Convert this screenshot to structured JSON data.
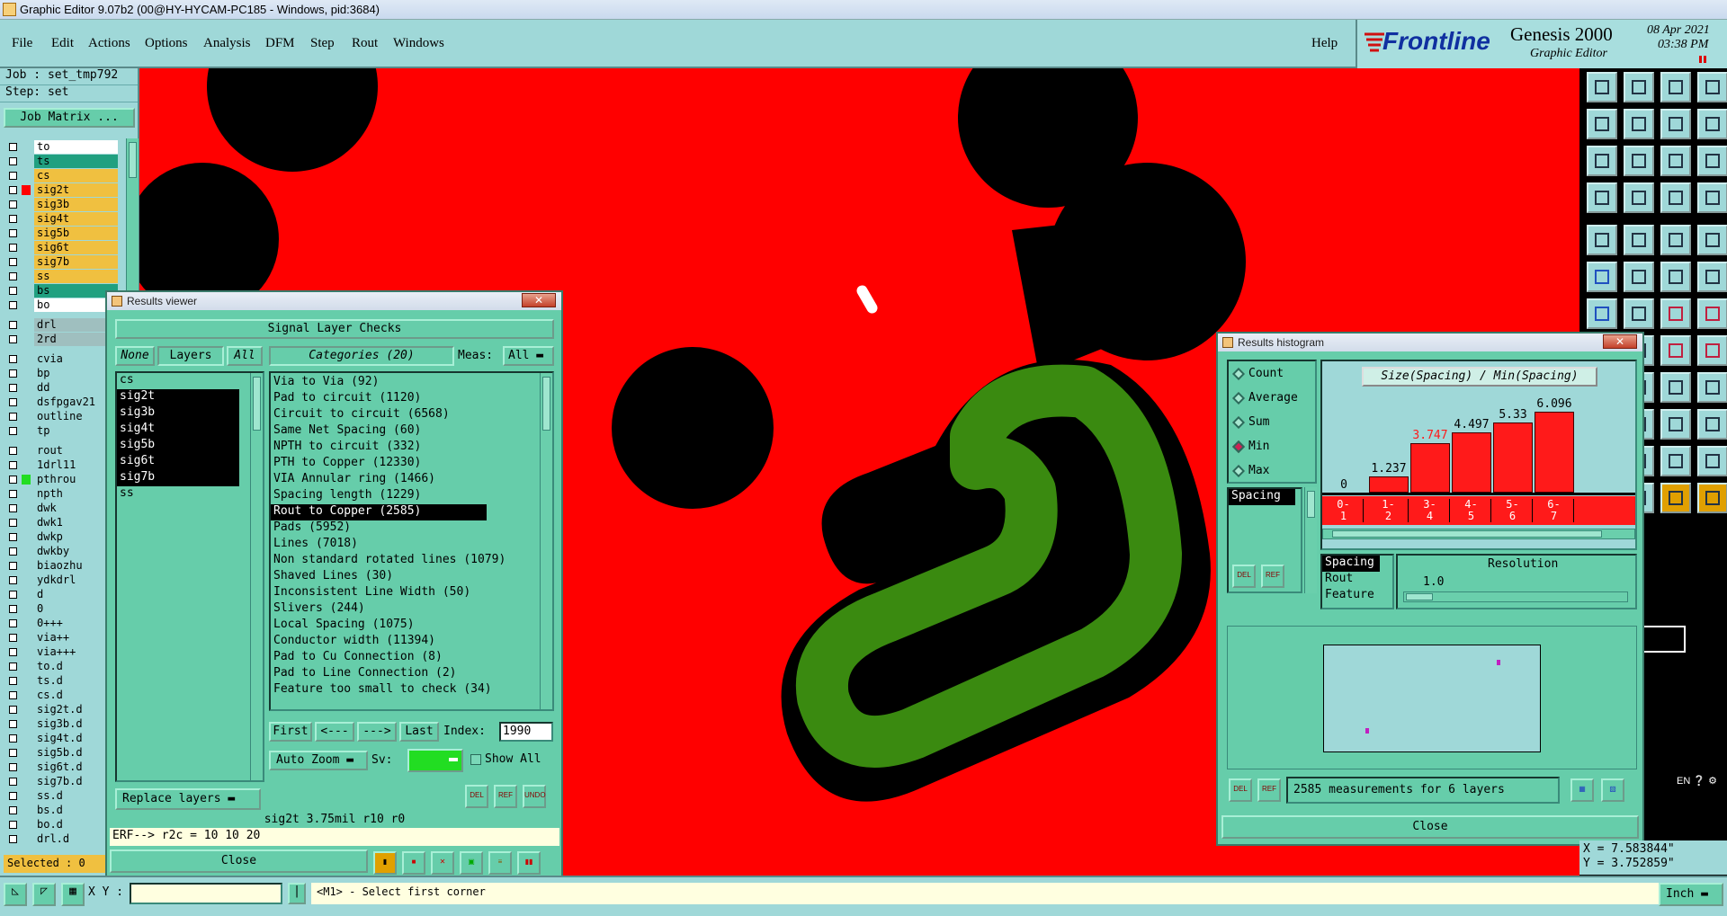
{
  "window": {
    "title": "Graphic Editor 9.07b2 (00@HY-HYCAM-PC185 - Windows, pid:3684)"
  },
  "menu": [
    "File",
    "Edit",
    "Actions",
    "Options",
    "Analysis",
    "DFM",
    "Step",
    "Rout",
    "Windows"
  ],
  "help": "Help",
  "brand": {
    "logo": "Frontline",
    "product": "Genesis 2000",
    "subtitle": "Graphic Editor",
    "date": "08 Apr 2021",
    "time": "03:38 PM"
  },
  "job": {
    "job_line": "Job : set_tmp792",
    "step_line": "Step: set",
    "matrix_button": "Job Matrix ..."
  },
  "layers": [
    {
      "name": "to",
      "color": "#ffffff"
    },
    {
      "name": "ts",
      "color": "#20a080"
    },
    {
      "name": "cs",
      "color": "#f0c040"
    },
    {
      "name": "sig2t",
      "color": "#f0c040"
    },
    {
      "name": "sig3b",
      "color": "#f0c040"
    },
    {
      "name": "sig4t",
      "color": "#f0c040"
    },
    {
      "name": "sig5b",
      "color": "#f0c040"
    },
    {
      "name": "sig6t",
      "color": "#f0c040"
    },
    {
      "name": "sig7b",
      "color": "#f0c040"
    },
    {
      "name": "ss",
      "color": "#f0c040"
    },
    {
      "name": "bs",
      "color": "#20a080"
    },
    {
      "name": "bo",
      "color": "#ffffff"
    },
    {
      "name": "drl",
      "color": "#9fbfbf"
    },
    {
      "name": "2rd",
      "color": "#9fbfbf"
    },
    {
      "name": "cvia",
      "color": "#9fd8d8"
    },
    {
      "name": "bp",
      "color": "#9fd8d8"
    },
    {
      "name": "dd",
      "color": "#9fd8d8"
    },
    {
      "name": "dsfpgav21",
      "color": "#9fd8d8"
    },
    {
      "name": "outline",
      "color": "#9fd8d8"
    },
    {
      "name": "tp",
      "color": "#9fd8d8"
    },
    {
      "name": "rout",
      "color": "#9fd8d8"
    },
    {
      "name": "1drl11",
      "color": "#9fd8d8"
    },
    {
      "name": "pthrou",
      "color": "#9fd8d8"
    },
    {
      "name": "npth",
      "color": "#9fd8d8"
    },
    {
      "name": "dwk",
      "color": "#9fd8d8"
    },
    {
      "name": "dwk1",
      "color": "#9fd8d8"
    },
    {
      "name": "dwkp",
      "color": "#9fd8d8"
    },
    {
      "name": "dwkby",
      "color": "#9fd8d8"
    },
    {
      "name": "biaozhu",
      "color": "#9fd8d8"
    },
    {
      "name": "ydkdrl",
      "color": "#9fd8d8"
    },
    {
      "name": "d",
      "color": "#9fd8d8"
    },
    {
      "name": "0",
      "color": "#9fd8d8"
    },
    {
      "name": "0+++",
      "color": "#9fd8d8"
    },
    {
      "name": "via++",
      "color": "#9fd8d8"
    },
    {
      "name": "via+++",
      "color": "#9fd8d8"
    },
    {
      "name": "to.d",
      "color": "#9fd8d8"
    },
    {
      "name": "ts.d",
      "color": "#9fd8d8"
    },
    {
      "name": "cs.d",
      "color": "#9fd8d8"
    },
    {
      "name": "sig2t.d",
      "color": "#9fd8d8"
    },
    {
      "name": "sig3b.d",
      "color": "#9fd8d8"
    },
    {
      "name": "sig4t.d",
      "color": "#9fd8d8"
    },
    {
      "name": "sig5b.d",
      "color": "#9fd8d8"
    },
    {
      "name": "sig6t.d",
      "color": "#9fd8d8"
    },
    {
      "name": "sig7b.d",
      "color": "#9fd8d8"
    },
    {
      "name": "ss.d",
      "color": "#9fd8d8"
    },
    {
      "name": "bs.d",
      "color": "#9fd8d8"
    },
    {
      "name": "bo.d",
      "color": "#9fd8d8"
    },
    {
      "name": "drl.d",
      "color": "#9fd8d8"
    }
  ],
  "selected_count": "Selected : 0",
  "results_viewer": {
    "title": "Results viewer",
    "header": "Signal Layer Checks",
    "none_btn": "None",
    "layers_label": "Layers",
    "all_btn": "All",
    "categories_label": "Categories (20)",
    "meas_label": "Meas:",
    "meas_value": "All",
    "layers": [
      "cs",
      "sig2t",
      "sig3b",
      "sig4t",
      "sig5b",
      "sig6t",
      "sig7b",
      "ss"
    ],
    "categories": [
      "Via to Via (92)",
      "Pad to circuit (1120)",
      "Circuit to circuit (6568)",
      "Same Net Spacing (60)",
      "NPTH to circuit (332)",
      "PTH to Copper (12330)",
      "VIA Annular ring (1466)",
      "Spacing length (1229)",
      "Rout to Copper (2585)",
      "Pads (5952)",
      "Lines (7018)",
      "Non standard rotated lines (1079)",
      "Shaved Lines (30)",
      "Inconsistent Line Width (50)",
      "Slivers (244)",
      "Local Spacing (1075)",
      "Conductor width (11394)",
      "Pad to Cu Connection (8)",
      "Pad to Line Connection (2)",
      "Feature too small to check (34)"
    ],
    "first": "First",
    "prev": "<---",
    "next": "--->",
    "last": "Last",
    "index_label": "Index:",
    "index_value": "1990",
    "auto_zoom": "Auto Zoom",
    "sv_label": "Sv:",
    "show_all": "Show All",
    "replace_layers": "Replace layers",
    "small_btns": [
      "DEL",
      "REF",
      "UNDO"
    ],
    "info": "sig2t 3.75mil  r10  r0",
    "erf": "ERF--> r2c = 10 10 20",
    "close": "Close"
  },
  "histogram": {
    "title": "Results histogram",
    "modes": [
      "Count",
      "Average",
      "Sum",
      "Min",
      "Max"
    ],
    "selected_mode": "Min",
    "chart_title": "Size(Spacing) / Min(Spacing)",
    "list_item": "Spacing",
    "bins": [
      "0-\n1",
      "1-\n2",
      "3-\n4",
      "4-\n5",
      "5-\n6",
      "6-\n7"
    ],
    "values": [
      "0",
      "1.237",
      "3.747",
      "4.497",
      "5.33",
      "6.096"
    ],
    "bar_levels": [
      0,
      0.2,
      0.61,
      0.74,
      0.87,
      1.0
    ],
    "attr_list": [
      "Spacing",
      "Rout",
      "Feature"
    ],
    "resolution_label": "Resolution",
    "resolution_value": "1.0",
    "measurements": "2585 measurements for 6 layers",
    "close": "Close",
    "small_btns": [
      "DEL",
      "REF"
    ]
  },
  "coords": {
    "x": "X = 7.583844\"",
    "y": "Y = 3.752859\""
  },
  "status": {
    "xy_label": "X Y :",
    "prompt": "<M1> - Select first corner",
    "units": "Inch"
  },
  "lang": "EN"
}
